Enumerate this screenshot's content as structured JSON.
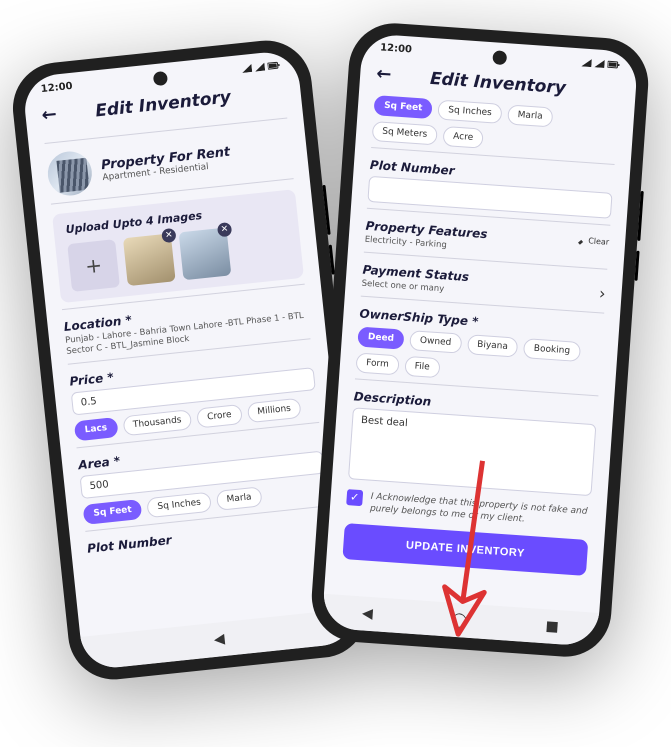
{
  "status_time": "12:00",
  "header": {
    "back_icon": "←",
    "title": "Edit Inventory"
  },
  "phone1": {
    "property": {
      "title": "Property For Rent",
      "subtitle": "Apartment - Residential"
    },
    "upload": {
      "title": "Upload Upto 4 Images"
    },
    "location": {
      "label": "Location *",
      "value": "Punjab - Lahore - Bahria Town Lahore -BTL Phase 1 - BTL Sector C - BTL_Jasmine Block"
    },
    "price": {
      "label": "Price *",
      "value": "0.5",
      "units": [
        "Lacs",
        "Thousands",
        "Crore",
        "Millions"
      ],
      "selected": "Lacs"
    },
    "area": {
      "label": "Area *",
      "value": "500",
      "units": [
        "Sq Feet",
        "Sq Inches",
        "Marla"
      ],
      "selected": "Sq Feet"
    },
    "plot_number": {
      "label": "Plot Number"
    }
  },
  "phone2": {
    "area_units": {
      "options": [
        "Sq Feet",
        "Sq Inches",
        "Marla",
        "Sq Meters",
        "Acre"
      ],
      "selected": "Sq Feet"
    },
    "plot_number": {
      "label": "Plot Number",
      "value": ""
    },
    "features": {
      "label": "Property Features",
      "value": "Electricity - Parking",
      "clear": "Clear"
    },
    "payment": {
      "label": "Payment Status",
      "sub": "Select one or many"
    },
    "ownership": {
      "label": "OwnerShip Type *",
      "options": [
        "Deed",
        "Owned",
        "Biyana",
        "Booking",
        "Form",
        "File"
      ],
      "selected": "Deed"
    },
    "description": {
      "label": "Description",
      "value": "Best deal"
    },
    "ack": "I Acknowledge that this property is not fake and purely belongs to me or my client.",
    "cta": "UPDATE INVENTORY"
  },
  "nav": {
    "back": "◀",
    "home": "◯",
    "recent": "■"
  },
  "colors": {
    "accent": "#6a4cff"
  }
}
